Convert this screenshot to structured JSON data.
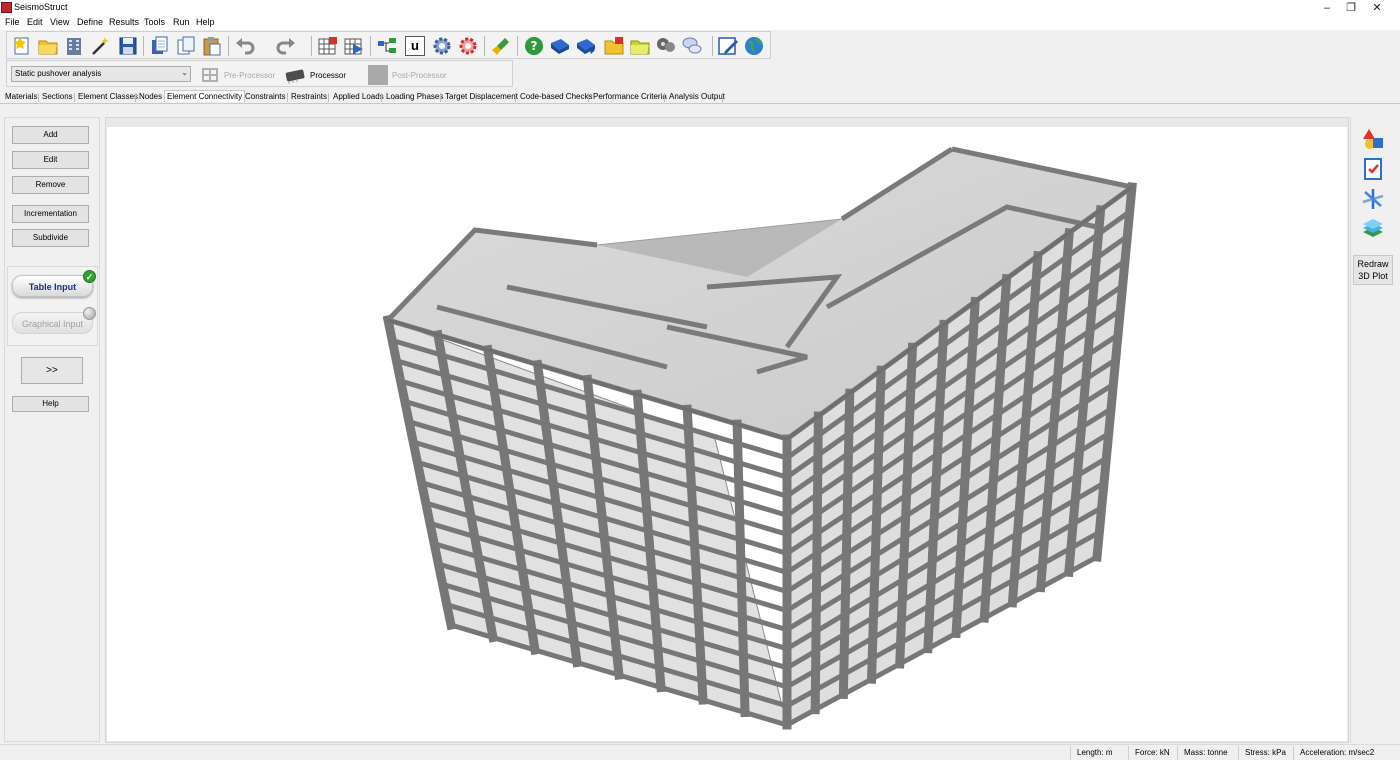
{
  "app": {
    "title": "SeismoStruct"
  },
  "window_controls": {
    "minimize": "–",
    "restore": "❐",
    "close": "✕"
  },
  "menu": [
    "File",
    "Edit",
    "View",
    "Define",
    "Results",
    "Tools",
    "Run",
    "Help"
  ],
  "toolbar": {
    "icons": [
      "new-file-icon",
      "open-folder-icon",
      "building-icon",
      "wizard-wand-icon",
      "save-icon",
      "copy-icon",
      "copy-pages-icon",
      "paste-icon",
      "undo-icon",
      "redo-icon",
      "frame-grid-icon",
      "frame-grid-run-icon",
      "structure-nodes-icon",
      "units-icon",
      "settings-gear-icon",
      "settings-gear-red-icon",
      "clean-brush-icon",
      "help-icon",
      "book-blue-icon",
      "book-tutorial-icon",
      "folder-star-icon",
      "folder-examples-icon",
      "film-reel-icon",
      "chat-icon",
      "edit-pencil-icon",
      "globe-icon"
    ],
    "units_label": "u"
  },
  "analysis": {
    "type_value": "Static pushover analysis",
    "pre_processor_label": "Pre-Processor",
    "processor_label": "Processor",
    "post_processor_label": "Post-Processor"
  },
  "tabs": [
    "Materials",
    "Sections",
    "Element Classes",
    "Nodes",
    "Element Connectivity",
    "Constraints",
    "Restraints",
    "Applied Loads",
    "Loading Phases",
    "Target Displacement",
    "Code-based Checks",
    "Performance Criteria",
    "Analysis Output"
  ],
  "active_tab": "Element Connectivity",
  "left_panel": {
    "add": "Add",
    "edit": "Edit",
    "remove": "Remove",
    "incrementation": "Incrementation",
    "subdivide": "Subdivide",
    "table_input": "Table Input",
    "graphical_input": "Graphical Input",
    "expand": ">>",
    "help": "Help"
  },
  "right_panel": {
    "icons": [
      "shapes-icon",
      "checklist-icon",
      "axes-icon",
      "layers-icon"
    ],
    "redraw_line1": "Redraw",
    "redraw_line2": "3D Plot"
  },
  "status": {
    "length": "Length: m",
    "force": "Force: kN",
    "mass": "Mass: tonne",
    "stress": "Stress: kPa",
    "acceleration": "Acceleration: m/sec2"
  },
  "colors": {
    "accent_blue": "#1a2e8a",
    "check_green": "#34a232",
    "frame_grey": "#7a7a7a"
  }
}
